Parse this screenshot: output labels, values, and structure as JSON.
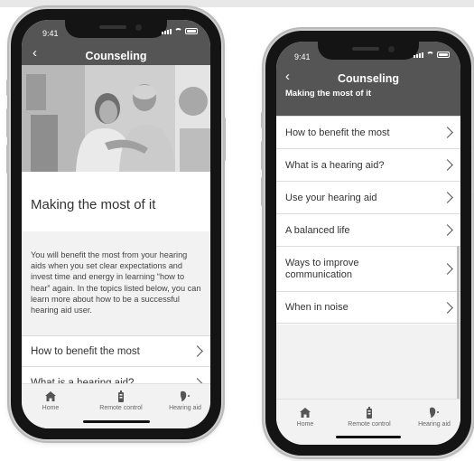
{
  "status": {
    "time": "9:41"
  },
  "left_screen": {
    "header": {
      "back": "‹",
      "title": "Counseling"
    },
    "article": {
      "title": "Making the most of it",
      "body": "You will benefit the most from your hearing aids when you set clear expectations and invest time and energy in learning “how to hear” again. In the topics listed below, you can learn more about how to be a successful hearing aid user."
    },
    "items": [
      {
        "label": "How to benefit the most"
      },
      {
        "label": "What is a hearing aid?"
      }
    ]
  },
  "right_screen": {
    "header": {
      "back": "‹",
      "title": "Counseling",
      "subtitle": "Making the most of it"
    },
    "items": [
      {
        "label": "How to benefit the most"
      },
      {
        "label": "What is a hearing aid?"
      },
      {
        "label": "Use your hearing aid"
      },
      {
        "label": "A balanced life"
      },
      {
        "label": "Ways to improve communication"
      },
      {
        "label": "When in noise"
      }
    ]
  },
  "tabbar": {
    "tabs": [
      {
        "label": "Home",
        "icon": "home-icon"
      },
      {
        "label": "Remote control",
        "icon": "remote-control-icon"
      },
      {
        "label": "Hearing aid",
        "icon": "hearing-aid-icon"
      }
    ]
  },
  "colors": {
    "header": "#555555",
    "tabbar": "#f2f2f2",
    "text": "#333333",
    "phone_frame": "#141414"
  }
}
